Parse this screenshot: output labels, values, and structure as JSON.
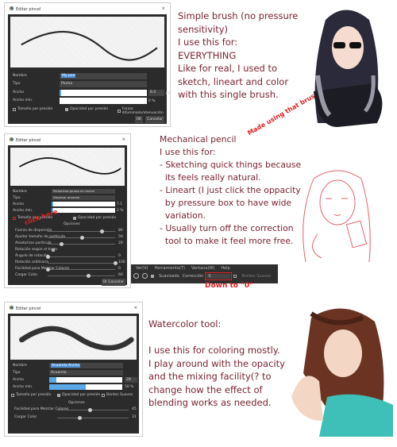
{
  "dialog_title": "Editar pincel",
  "close": "×",
  "labels": {
    "name": "Nombre",
    "type": "Tipo",
    "width": "Ancho",
    "minwidth": "Ancho mín.",
    "size_pressure": "Tamaño por presión",
    "opacity_pressure": "Opacidad por presión",
    "options": "Opciones",
    "ok": "OK",
    "cancel": "Cancelar"
  },
  "brush1": {
    "name": "My pen",
    "type": "Pluma",
    "width": "8.4",
    "width_unit": "px",
    "width_fill": 0.02,
    "minwidth": "0 %",
    "minwidth_fill": 0,
    "size_pressure": false,
    "opacity_pressure": true,
    "extra_check": "Forzar difuminado/atenuación",
    "extra_checked": false
  },
  "brush2": {
    "name": "Portaminas grueso en mezcla",
    "type": "Dispersar acuarela",
    "width": "7.1",
    "width_unit": "px",
    "width_fill": 0.02,
    "minwidth": "2 %",
    "minwidth_fill": 0.02,
    "opacity_pressure": true,
    "options": [
      {
        "label": "Fuerza de dispersión",
        "value": 80
      },
      {
        "label": "Ajustar tamaño de partícula",
        "value": 50
      },
      {
        "label": "Aleatorizar partícula",
        "value": 20
      },
      {
        "label": "Rotación según el trazo",
        "checkbox": true
      },
      {
        "label": "Ángulo de rotación",
        "value": 0
      },
      {
        "label": "Rotación arbitraria",
        "value": 100
      },
      {
        "label": "Facilidad para Mezclar Colores",
        "value": 0
      },
      {
        "label": "Cargar Color",
        "value": 60
      }
    ]
  },
  "brush3": {
    "name": "Acuarela Ancha",
    "type": "Acuarela",
    "width": "29",
    "width_unit": "px",
    "width_fill": 0.1,
    "minwidth": "50 %",
    "minwidth_fill": 0.5,
    "size_pressure": false,
    "opacity_pressure": true,
    "extra_check": "Bordes Suaves",
    "extra_checked": false,
    "options": [
      {
        "label": "Facilidad para Mezclar Colores",
        "value": 45
      },
      {
        "label": "Cargar Color",
        "value": 31
      }
    ]
  },
  "toolbar": {
    "menus": [
      "Ver(V)",
      "Herramienta(T)",
      "Ventana(W)",
      "Help"
    ],
    "suavizado": "Suavizado",
    "correccion": "Corrección",
    "correccion_value": "0",
    "bordes": "Bordes Suaves"
  },
  "notes": {
    "simple": "Simple brush (no pressure\nsensitivity)\nI use this for:\nEVERYTHING\nLike for real, I used to\nsketch, lineart and color\nwith this single brush.",
    "pencil": "Mechanical pencil\nI use this for:\n- Sketching quick things because\n  its feels really natural.\n- Lineart (I just click the oppacity\n  by pressure box to have wide\n  variation.\n- Usually turn off the correction\n  tool to make it feel more free.",
    "water": "Watercolor tool:\n\nI use this for coloring mostly.\nI play around with the opacity\nand the mixing facility(? to\nchange how the effect of\nblending works as needed."
  },
  "annotations": {
    "made": "Made using that brush →",
    "click": "click here",
    "down": "Down to \"0\""
  },
  "colors": {
    "text": "#7a2232",
    "annotation": "#e02020",
    "panel": "#2b2b2b",
    "accent": "#5aa9e6"
  }
}
